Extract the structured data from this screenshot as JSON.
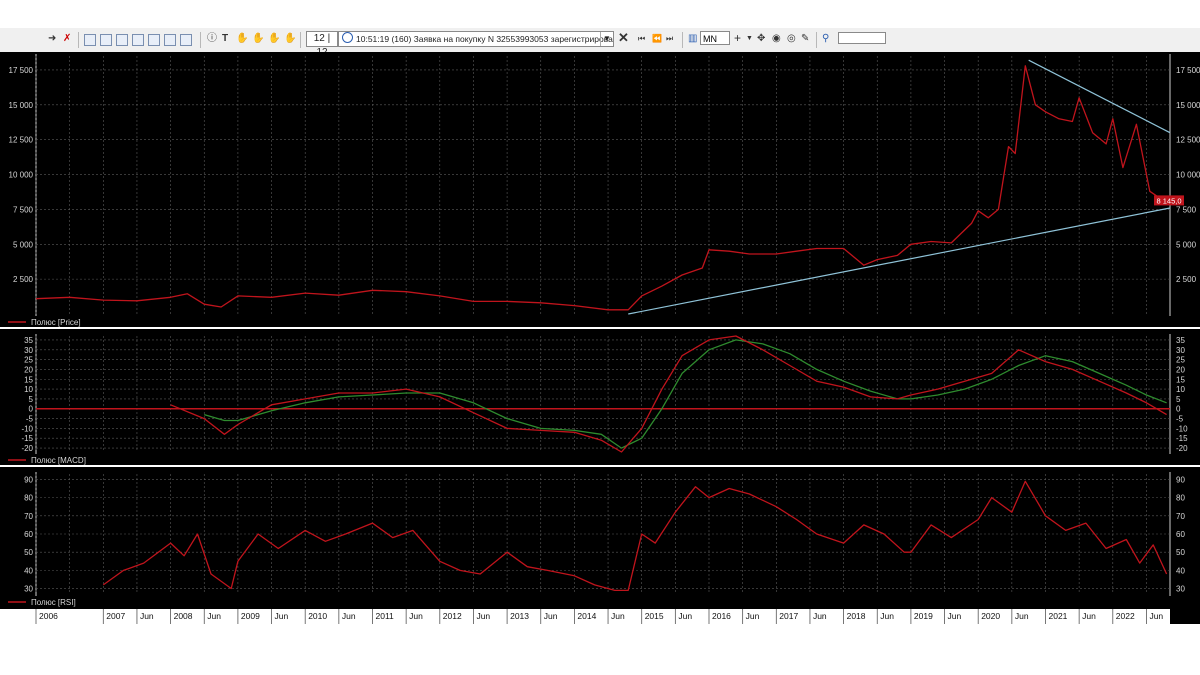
{
  "toolbar": {
    "counter": "12 | 12",
    "message": "10:51:19  (160) Заявка на покупку N 32553993053 зарегистрирована.",
    "timeframe": "MN",
    "search_value": ""
  },
  "colors": {
    "background": "#000000",
    "price_line": "#c0141c",
    "signal_line": "#2e8b2e",
    "trend_line": "#8fc3d8",
    "grid": "#5a5a5a",
    "price_label_bg": "#c0141c"
  },
  "chart_data": [
    {
      "type": "line",
      "panel": "price",
      "legend": "Полюс [Price]",
      "current_value_label": "8 145,0",
      "ylim": [
        0,
        18500
      ],
      "yticks": [
        2500,
        5000,
        7500,
        10000,
        12500,
        15000,
        17500
      ],
      "ytick_labels": [
        "2 500",
        "5 000",
        "7 500",
        "10 000",
        "12 500",
        "15 000",
        "17 500"
      ],
      "x": [
        2006.0,
        2006.5,
        2007.0,
        2007.5,
        2008.0,
        2008.25,
        2008.5,
        2008.75,
        2009.0,
        2009.5,
        2010.0,
        2010.5,
        2011.0,
        2011.5,
        2012.0,
        2012.5,
        2013.0,
        2013.5,
        2014.0,
        2014.5,
        2014.8,
        2015.0,
        2015.3,
        2015.6,
        2015.9,
        2016.0,
        2016.3,
        2016.6,
        2017.0,
        2017.3,
        2017.6,
        2018.0,
        2018.3,
        2018.5,
        2018.8,
        2019.0,
        2019.3,
        2019.6,
        2019.9,
        2020.0,
        2020.15,
        2020.3,
        2020.45,
        2020.55,
        2020.7,
        2020.85,
        2021.0,
        2021.2,
        2021.4,
        2021.5,
        2021.7,
        2021.9,
        2022.0,
        2022.15,
        2022.35,
        2022.55,
        2022.75
      ],
      "values": [
        1100,
        1200,
        1000,
        950,
        1200,
        1450,
        700,
        500,
        1300,
        1200,
        1500,
        1350,
        1700,
        1600,
        1300,
        900,
        900,
        800,
        600,
        300,
        300,
        1300,
        2000,
        2800,
        3300,
        4600,
        4500,
        4300,
        4300,
        4500,
        4700,
        4700,
        3500,
        3900,
        4200,
        5000,
        5200,
        5100,
        6500,
        7400,
        6900,
        7500,
        12000,
        11500,
        17800,
        15000,
        14500,
        14000,
        13800,
        15500,
        13000,
        12200,
        14000,
        10500,
        13600,
        8800,
        8145
      ],
      "trendlines": [
        {
          "from": [
            2014.8,
            0
          ],
          "to": [
            2022.85,
            7600
          ]
        },
        {
          "from": [
            2020.75,
            18200
          ],
          "to": [
            2022.85,
            13000
          ]
        }
      ]
    },
    {
      "type": "line",
      "panel": "macd",
      "legend": "Полюс [MACD]",
      "ylim": [
        -22,
        37
      ],
      "yticks": [
        -20,
        -15,
        -10,
        -5,
        0,
        5,
        10,
        15,
        20,
        25,
        30,
        35
      ],
      "ytick_labels": [
        "-20",
        "-15",
        "-10",
        "-5",
        "0",
        "5",
        "10",
        "15",
        "20",
        "25",
        "30",
        "35"
      ],
      "x": [
        2008.0,
        2008.5,
        2008.8,
        2009.0,
        2009.5,
        2010.0,
        2010.5,
        2011.0,
        2011.5,
        2012.0,
        2012.5,
        2013.0,
        2013.5,
        2014.0,
        2014.4,
        2014.7,
        2015.0,
        2015.3,
        2015.6,
        2016.0,
        2016.4,
        2016.8,
        2017.2,
        2017.6,
        2018.0,
        2018.4,
        2018.8,
        2019.0,
        2019.4,
        2019.8,
        2020.2,
        2020.6,
        2021.0,
        2021.4,
        2021.8,
        2022.2,
        2022.5,
        2022.8
      ],
      "series": [
        {
          "values": [
            2,
            -5,
            -13,
            -8,
            2,
            5,
            8,
            8,
            10,
            6,
            -2,
            -10,
            -11,
            -12,
            -16,
            -22,
            -10,
            10,
            27,
            35,
            37,
            30,
            22,
            14,
            11,
            6,
            5,
            7,
            10,
            14,
            18,
            30,
            24,
            20,
            14,
            8,
            3,
            -3
          ]
        },
        {
          "values": [
            null,
            -3,
            -6,
            -6,
            -1,
            3,
            6,
            7,
            8,
            8,
            3,
            -5,
            -10,
            -11,
            -13,
            -20,
            -15,
            0,
            18,
            30,
            35,
            33,
            28,
            20,
            14,
            9,
            5,
            5,
            7,
            10,
            15,
            22,
            27,
            24,
            18,
            12,
            7,
            3
          ]
        }
      ]
    },
    {
      "type": "line",
      "panel": "rsi",
      "legend": "Полюс [RSI]",
      "ylim": [
        27,
        93
      ],
      "yticks": [
        30,
        40,
        50,
        60,
        70,
        80,
        90
      ],
      "ytick_labels": [
        "30",
        "40",
        "50",
        "60",
        "70",
        "80",
        "90"
      ],
      "x": [
        2007.0,
        2007.3,
        2007.6,
        2008.0,
        2008.2,
        2008.4,
        2008.6,
        2008.9,
        2009.0,
        2009.3,
        2009.6,
        2010.0,
        2010.3,
        2010.6,
        2011.0,
        2011.3,
        2011.6,
        2012.0,
        2012.3,
        2012.6,
        2013.0,
        2013.3,
        2013.6,
        2014.0,
        2014.3,
        2014.6,
        2014.8,
        2015.0,
        2015.2,
        2015.5,
        2015.8,
        2016.0,
        2016.3,
        2016.6,
        2017.0,
        2017.3,
        2017.6,
        2018.0,
        2018.3,
        2018.6,
        2018.9,
        2019.0,
        2019.3,
        2019.6,
        2020.0,
        2020.2,
        2020.5,
        2020.7,
        2021.0,
        2021.3,
        2021.6,
        2021.9,
        2022.2,
        2022.4,
        2022.6,
        2022.8
      ],
      "values": [
        32,
        40,
        44,
        55,
        48,
        60,
        38,
        30,
        45,
        60,
        52,
        62,
        56,
        60,
        66,
        58,
        62,
        45,
        40,
        38,
        50,
        42,
        40,
        37,
        32,
        29,
        29,
        60,
        55,
        72,
        86,
        80,
        85,
        82,
        75,
        68,
        60,
        55,
        65,
        60,
        50,
        50,
        65,
        58,
        68,
        80,
        72,
        89,
        70,
        62,
        66,
        52,
        57,
        44,
        54,
        38
      ]
    }
  ],
  "x_axis": {
    "xlim": [
      2006.0,
      2022.85
    ],
    "labels": [
      "2006",
      "2007",
      "Jun",
      "2008",
      "Jun",
      "2009",
      "Jun",
      "2010",
      "Jun",
      "2011",
      "Jun",
      "2012",
      "Jun",
      "2013",
      "Jun",
      "2014",
      "Jun",
      "2015",
      "Jun",
      "2016",
      "Jun",
      "2017",
      "Jun",
      "2018",
      "Jun",
      "2019",
      "Jun",
      "2020",
      "Jun",
      "2021",
      "Jun",
      "2022",
      "Jun"
    ],
    "label_positions": [
      2006.0,
      2007.0,
      2007.5,
      2008.0,
      2008.5,
      2009.0,
      2009.5,
      2010.0,
      2010.5,
      2011.0,
      2011.5,
      2012.0,
      2012.5,
      2013.0,
      2013.5,
      2014.0,
      2014.5,
      2015.0,
      2015.5,
      2016.0,
      2016.5,
      2017.0,
      2017.5,
      2018.0,
      2018.5,
      2019.0,
      2019.5,
      2020.0,
      2020.5,
      2021.0,
      2021.5,
      2022.0,
      2022.5
    ]
  }
}
